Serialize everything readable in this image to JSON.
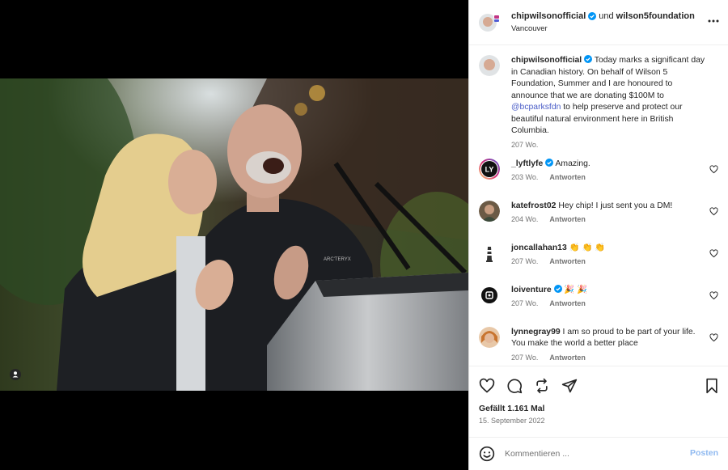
{
  "header": {
    "author": "chipwilsonofficial",
    "conjunction": "und",
    "coauthor": "wilson5foundation",
    "location": "Vancouver"
  },
  "caption": {
    "username": "chipwilsonofficial",
    "text_before": " Today marks a significant day in Canadian history. On behalf of Wilson 5 Foundation, Summer and I are honoured to announce that we are donating $100M to ",
    "mention": "@bcparksfdn",
    "text_after": " to help preserve and protect our beautiful natural environment here in British Columbia.",
    "time": "207 Wo."
  },
  "comments": [
    {
      "username": "_lyftlyfe",
      "verified": true,
      "text": " Amazing.",
      "time": "203 Wo.",
      "reply": "Antworten"
    },
    {
      "username": "katefrost02",
      "verified": false,
      "text": " Hey chip! I just sent you a DM!",
      "time": "204 Wo.",
      "reply": "Antworten"
    },
    {
      "username": "joncallahan13",
      "verified": false,
      "text": " 👏 👏 👏",
      "time": "207 Wo.",
      "reply": "Antworten"
    },
    {
      "username": "loiventure",
      "verified": true,
      "text": " 🎉 🎉",
      "time": "207 Wo.",
      "reply": "Antworten"
    },
    {
      "username": "lynnegray99",
      "verified": false,
      "text": " I am so proud to be part of your life. You make the world a better place",
      "time": "207 Wo.",
      "reply": "Antworten"
    }
  ],
  "likes": "Gefällt 1.161 Mal",
  "date": "15. September 2022",
  "composer": {
    "placeholder": "Kommentieren ...",
    "post_label": "Posten"
  },
  "colors": {
    "verified": "#0095f6",
    "mention": "#4a5dc7",
    "post_button": "#8fb9f0"
  }
}
